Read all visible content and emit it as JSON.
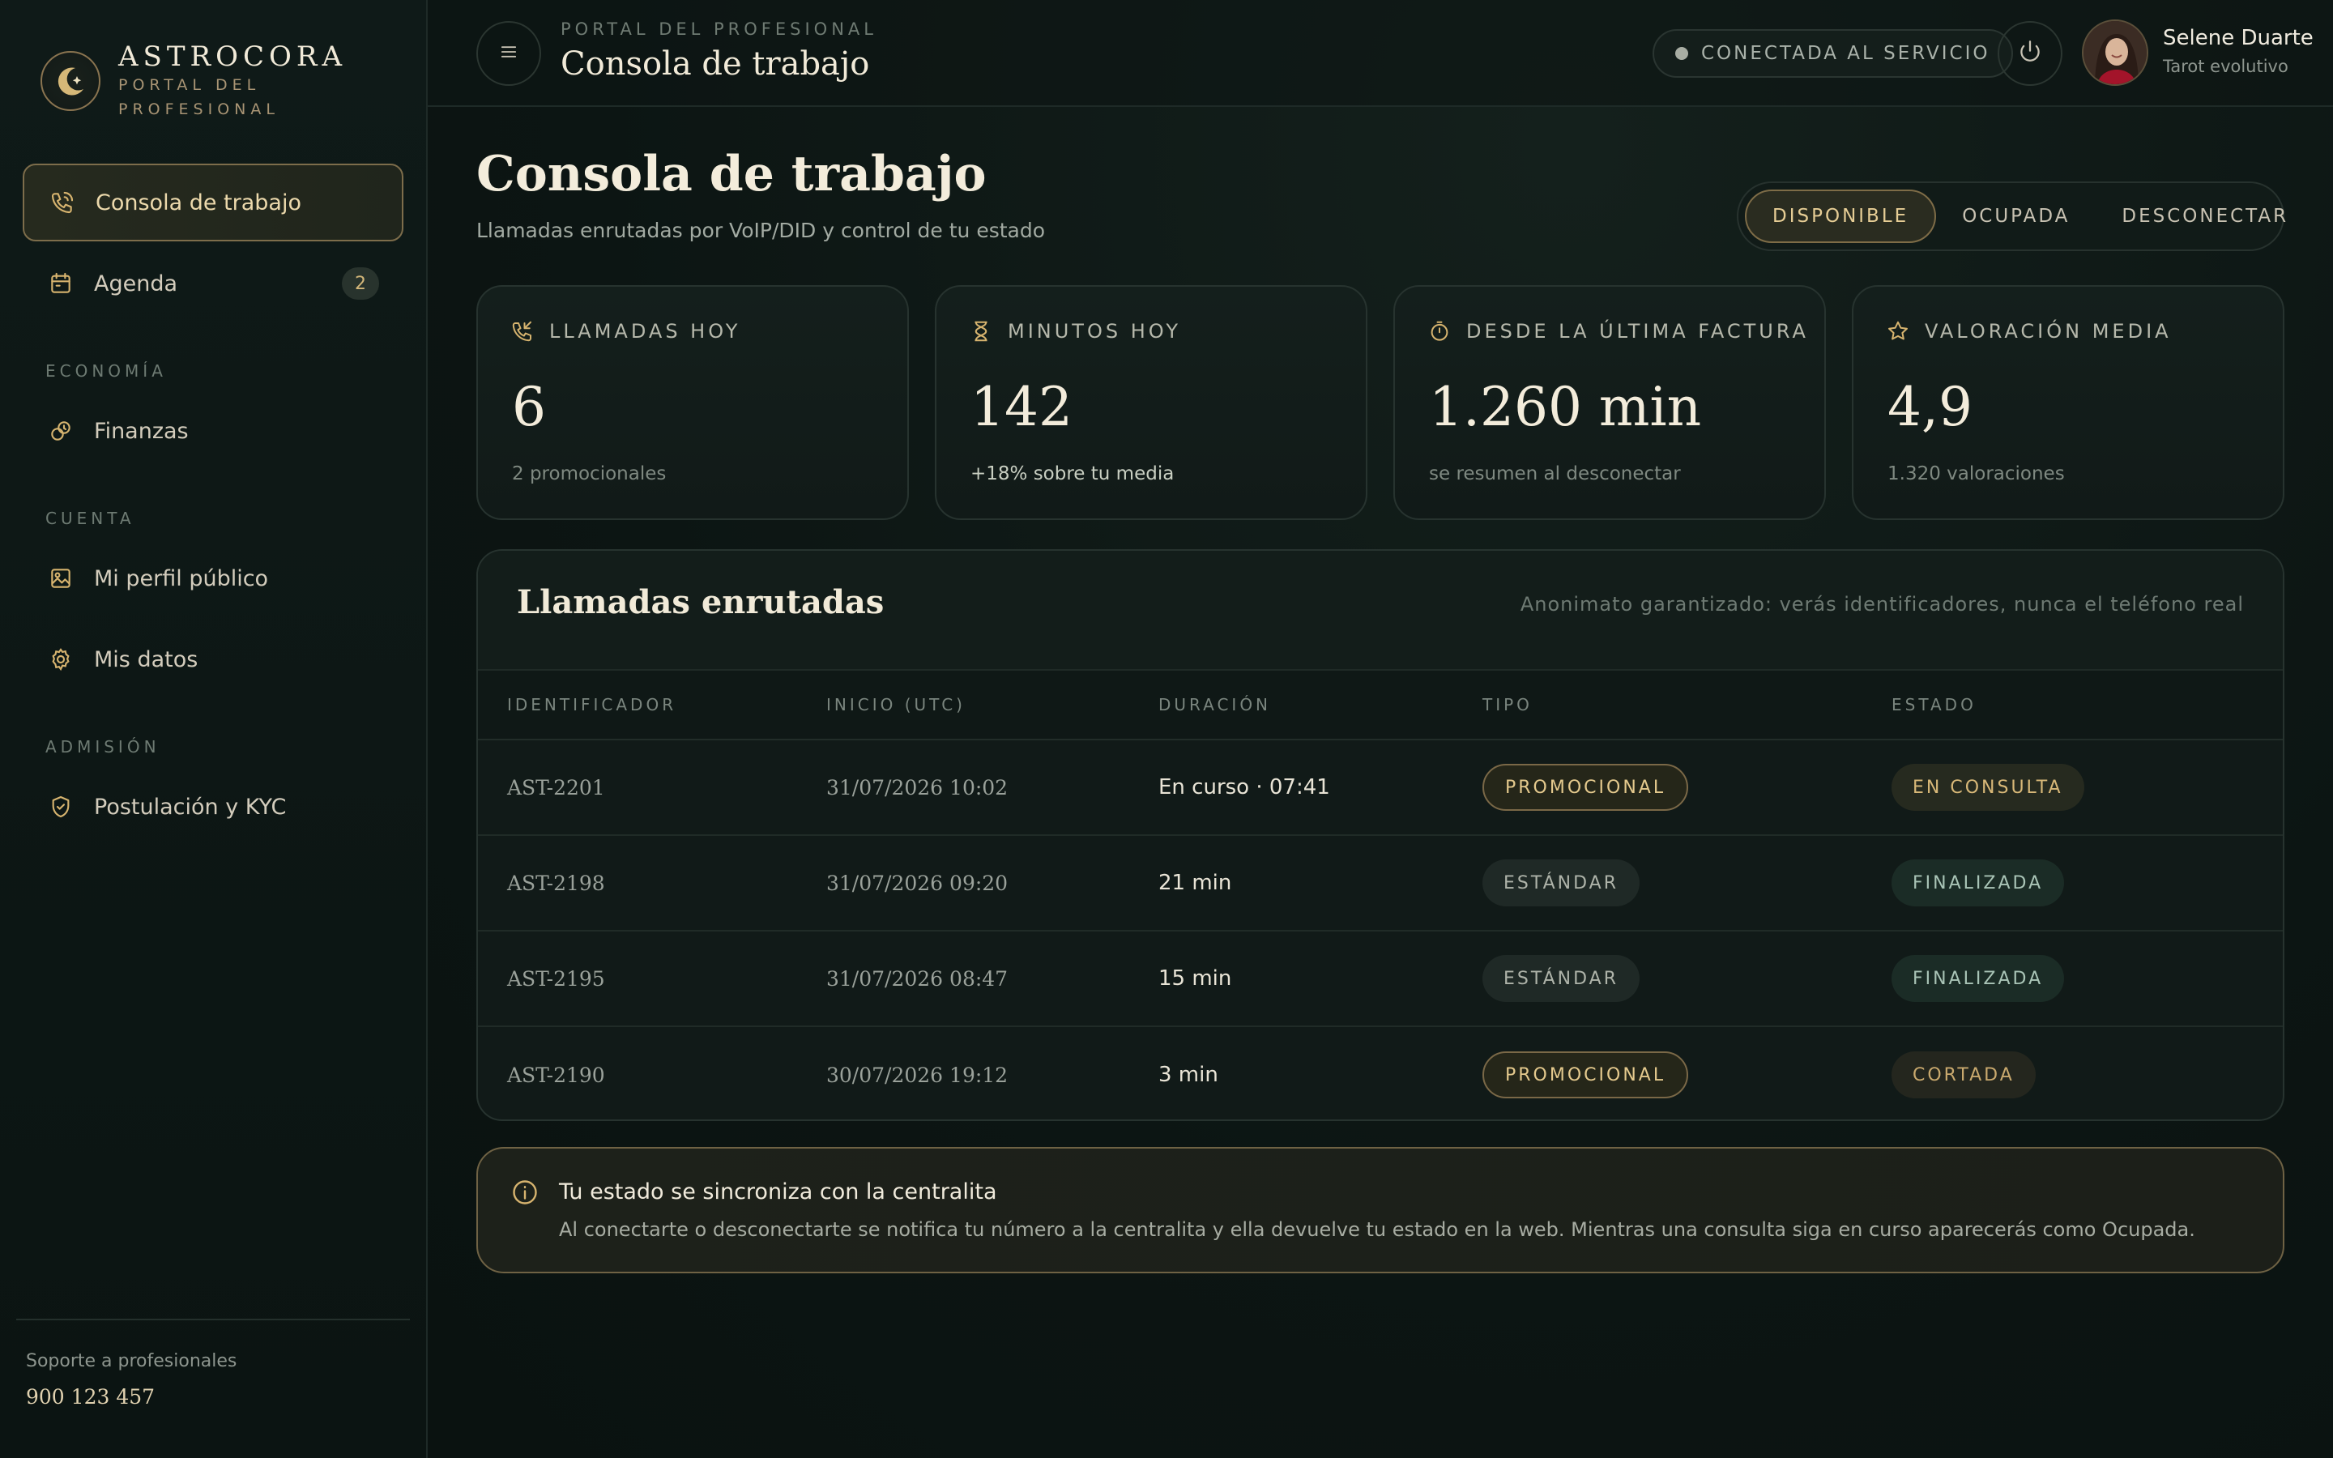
{
  "brand": {
    "name": "ASTROCORA",
    "sub": "PORTAL DEL PROFESIONAL"
  },
  "sidebar": {
    "items": [
      {
        "label": "Consola de trabajo",
        "icon": "phone-icon",
        "active": true
      },
      {
        "label": "Agenda",
        "icon": "calendar-icon",
        "badge": "2"
      }
    ],
    "sections": [
      {
        "title": "ECONOMÍA",
        "items": [
          {
            "label": "Finanzas",
            "icon": "coins-icon"
          }
        ]
      },
      {
        "title": "CUENTA",
        "items": [
          {
            "label": "Mi perfil público",
            "icon": "image-icon"
          },
          {
            "label": "Mis datos",
            "icon": "gear-icon"
          }
        ]
      },
      {
        "title": "ADMISIÓN",
        "items": [
          {
            "label": "Postulación y KYC",
            "icon": "shield-check-icon"
          }
        ]
      }
    ],
    "support_label": "Soporte a profesionales",
    "support_phone": "900 123 457"
  },
  "topbar": {
    "eyebrow": "PORTAL DEL PROFESIONAL",
    "title": "Consola de trabajo",
    "status": "CONECTADA AL SERVICIO",
    "user_name": "Selene Duarte",
    "user_role": "Tarot evolutivo"
  },
  "page": {
    "title": "Consola de trabajo",
    "subtitle": "Llamadas enrutadas por VoIP/DID y control de tu estado"
  },
  "availability": {
    "options": [
      "DISPONIBLE",
      "OCUPADA",
      "DESCONECTAR"
    ],
    "selected": "DISPONIBLE"
  },
  "stats": [
    {
      "label": "LLAMADAS HOY",
      "icon": "phone-incoming-icon",
      "value": "6",
      "note": "2 promocionales"
    },
    {
      "label": "MINUTOS HOY",
      "icon": "hourglass-icon",
      "value": "142",
      "note": "+18% sobre tu media"
    },
    {
      "label": "DESDE LA ÚLTIMA FACTURA",
      "icon": "stopwatch-icon",
      "value": "1.260 min",
      "note": "se resumen al desconectar"
    },
    {
      "label": "VALORACIÓN MEDIA",
      "icon": "star-icon",
      "value": "4,9",
      "note": "1.320 valoraciones"
    }
  ],
  "calls": {
    "title": "Llamadas enrutadas",
    "note": "Anonimato garantizado: verás identificadores, nunca el teléfono real",
    "columns": [
      "IDENTIFICADOR",
      "INICIO (UTC)",
      "DURACIÓN",
      "TIPO",
      "ESTADO"
    ],
    "rows": [
      {
        "id": "AST-2201",
        "start": "31/07/2026 10:02",
        "duration": "En curso · 07:41",
        "type": "PROMOCIONAL",
        "status": "EN CONSULTA"
      },
      {
        "id": "AST-2198",
        "start": "31/07/2026 09:20",
        "duration": "21 min",
        "type": "ESTÁNDAR",
        "status": "FINALIZADA"
      },
      {
        "id": "AST-2195",
        "start": "31/07/2026 08:47",
        "duration": "15 min",
        "type": "ESTÁNDAR",
        "status": "FINALIZADA"
      },
      {
        "id": "AST-2190",
        "start": "30/07/2026 19:12",
        "duration": "3 min",
        "type": "PROMOCIONAL",
        "status": "CORTADA"
      }
    ]
  },
  "notice": {
    "title": "Tu estado se sincroniza con la centralita",
    "body": "Al conectarte o desconectarte se notifica tu número a la centralita y ella devuelve tu estado en la web. Mientras una consulta siga en curso aparecerás como Ocupada."
  },
  "colors": {
    "accent": "#d7b46f",
    "background": "#0c1513",
    "panel": "#111a18"
  }
}
